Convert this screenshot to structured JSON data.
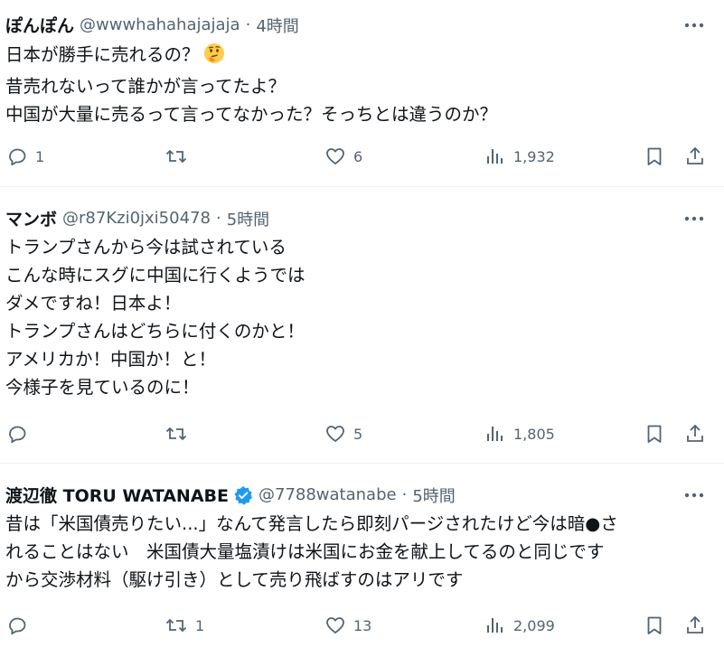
{
  "tweets": [
    {
      "name": "ぽんぽん",
      "handle": "@wwwhahahajajaja",
      "separator": "·",
      "time": "4時間",
      "lines": [
        "日本が勝手に売れるの？",
        "昔売れないって誰かが言ってたよ？",
        "中国が大量に売るって言ってなかった？そっちとは違うのか？"
      ],
      "emoji": "thinking-face",
      "replies": "1",
      "retweets": "",
      "likes": "6",
      "views": "1,932"
    },
    {
      "name": "マンボ",
      "handle": "@r87Kzi0jxi50478",
      "separator": "·",
      "time": "5時間",
      "lines": [
        "トランプさんから今は試されている",
        "こんな時にスグに中国に行くようでは",
        "ダメですね！日本よ！",
        "トランプさんはどちらに付くのかと！",
        "アメリカか！中国か！と！",
        "今様子を見ているのに！"
      ],
      "replies": "",
      "retweets": "",
      "likes": "5",
      "views": "1,805"
    },
    {
      "name": "渡辺徹 TORU WATANABE",
      "verified": true,
      "handle": "@7788watanabe",
      "separator": "·",
      "time": "5時間",
      "lines": [
        "昔は「米国債売りたい...」なんて発言したら即刻パージされたけど今は暗●さ",
        "れることはない　米国債大量塩漬けは米国にお金を献上してるのと同じです",
        "から交渉材料（駆け引き）として売り飛ばすのはアリです"
      ],
      "replies": "",
      "retweets": "1",
      "likes": "13",
      "views": "2,099"
    }
  ],
  "colors": {
    "text": "#0f1419",
    "secondary": "#536471",
    "verified": "#1d9bf0",
    "divider": "#eff3f4"
  }
}
